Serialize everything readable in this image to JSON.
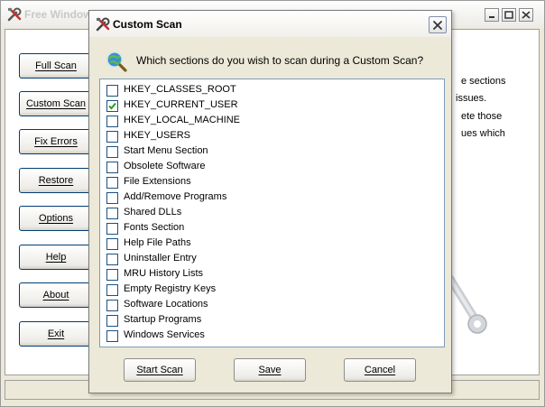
{
  "main_window": {
    "title": "Free Window",
    "buttons": [
      {
        "id": "full-scan",
        "label": "Full Scan"
      },
      {
        "id": "custom-scan",
        "label": "Custom Scan"
      },
      {
        "id": "fix-errors",
        "label": "Fix Errors"
      },
      {
        "id": "restore",
        "label": "Restore"
      },
      {
        "id": "options",
        "label": "Options"
      },
      {
        "id": "help",
        "label": "Help"
      },
      {
        "id": "about",
        "label": "About"
      },
      {
        "id": "exit",
        "label": "Exit"
      }
    ],
    "description_lines": [
      "e sections",
      "issues.",
      "ete those",
      "ues which"
    ]
  },
  "dialog": {
    "title": "Custom Scan",
    "question": "Which sections do you wish to scan during a Custom Scan?",
    "sections": [
      {
        "label": "HKEY_CLASSES_ROOT",
        "checked": false
      },
      {
        "label": "HKEY_CURRENT_USER",
        "checked": true
      },
      {
        "label": "HKEY_LOCAL_MACHINE",
        "checked": false
      },
      {
        "label": "HKEY_USERS",
        "checked": false
      },
      {
        "label": "Start Menu Section",
        "checked": false
      },
      {
        "label": "Obsolete Software",
        "checked": false
      },
      {
        "label": "File Extensions",
        "checked": false
      },
      {
        "label": "Add/Remove Programs",
        "checked": false
      },
      {
        "label": "Shared DLLs",
        "checked": false
      },
      {
        "label": "Fonts Section",
        "checked": false
      },
      {
        "label": "Help File Paths",
        "checked": false
      },
      {
        "label": "Uninstaller Entry",
        "checked": false
      },
      {
        "label": "MRU History Lists",
        "checked": false
      },
      {
        "label": "Empty Registry Keys",
        "checked": false
      },
      {
        "label": "Software Locations",
        "checked": false
      },
      {
        "label": "Startup Programs",
        "checked": false
      },
      {
        "label": "Windows Services",
        "checked": false
      }
    ],
    "buttons": {
      "start_scan": "Start Scan",
      "save": "Save",
      "cancel": "Cancel"
    }
  },
  "icons": {
    "title_icon": "tools-icon",
    "question_icon": "magnifier-globe-icon",
    "close_icon": "close-icon",
    "checkmark": "checkmark-icon"
  },
  "colors": {
    "window_face": "#ece9d8",
    "button_border": "#003c74",
    "list_border": "#7f9db9",
    "checkbox_border": "#1c5180"
  }
}
